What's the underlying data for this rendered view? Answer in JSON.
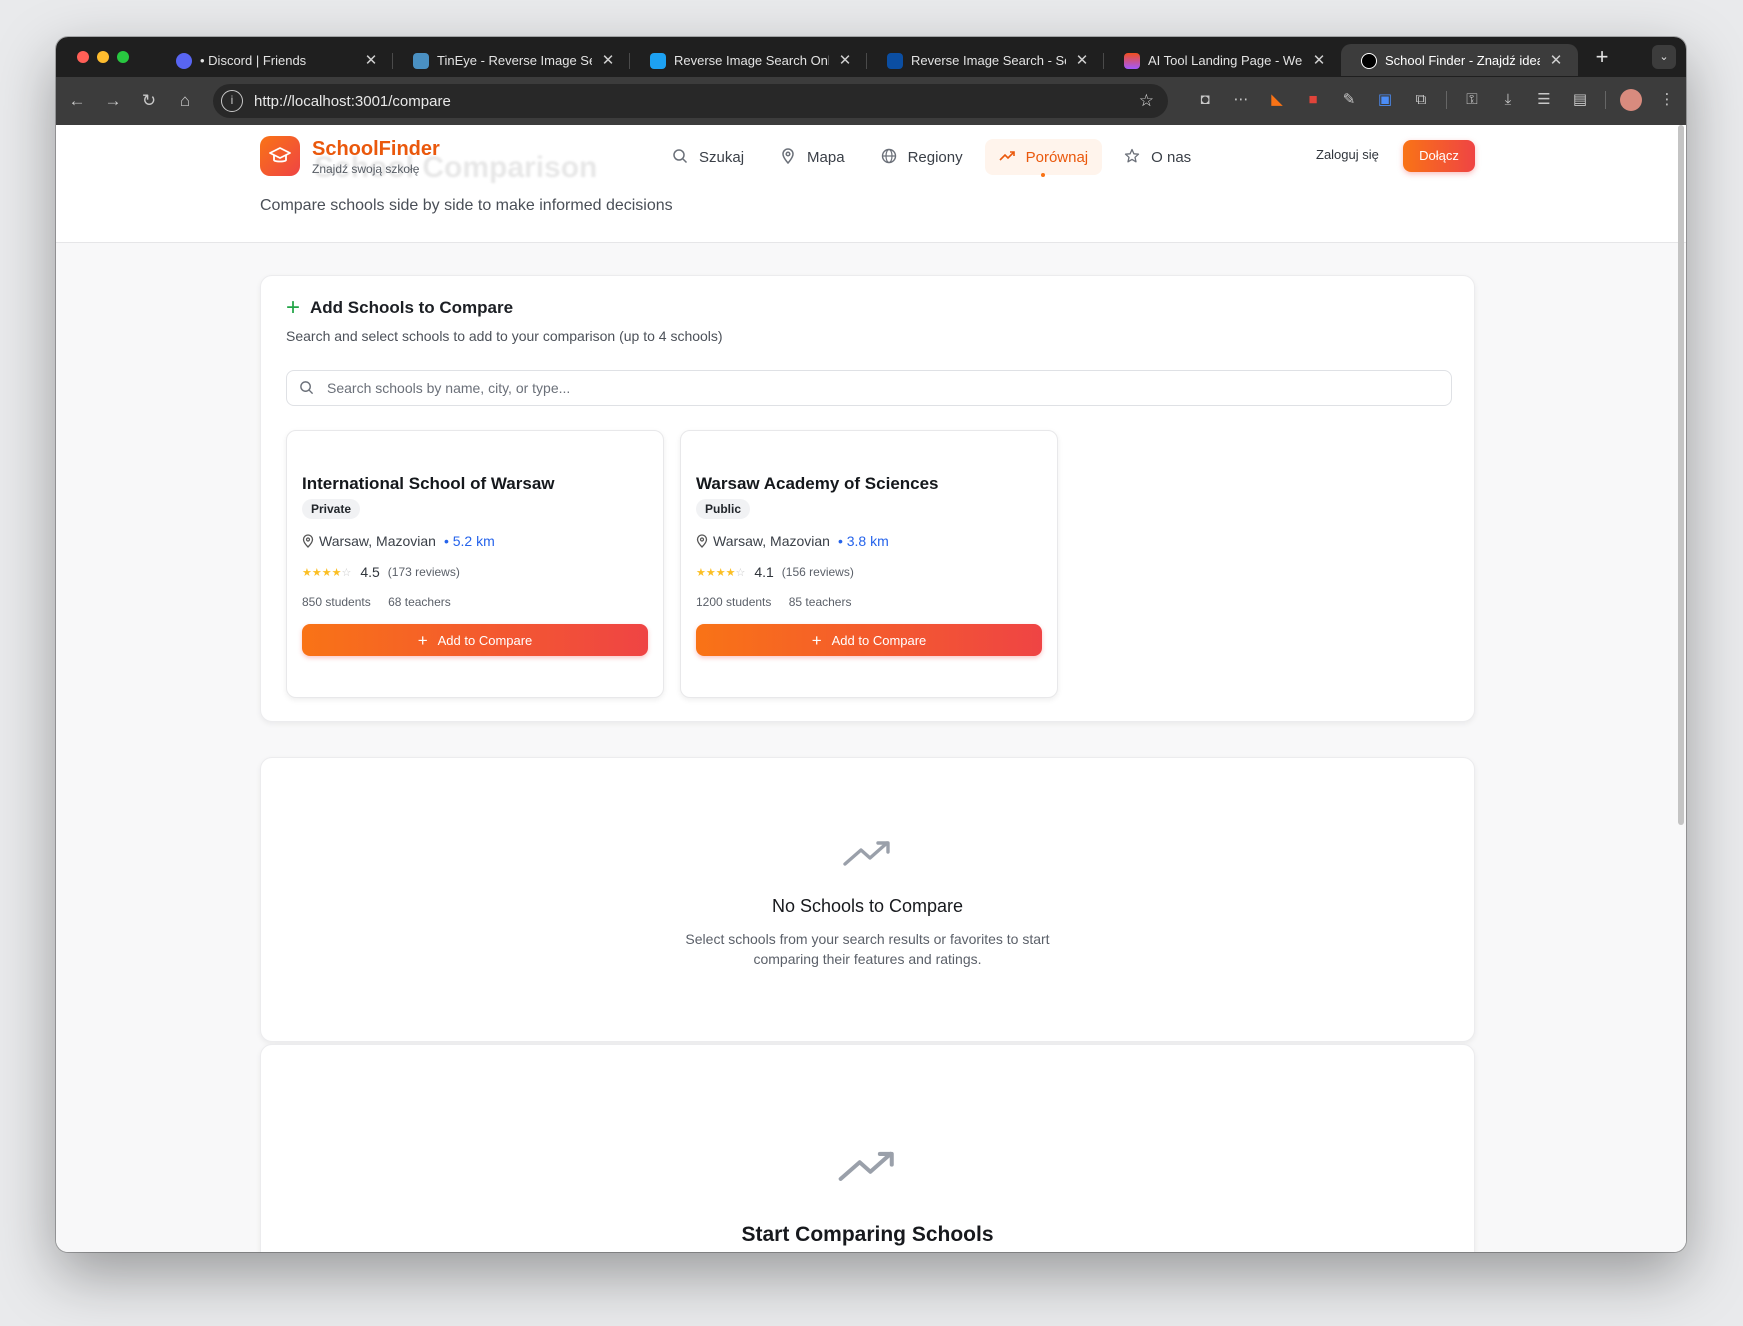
{
  "browser": {
    "tabs": [
      {
        "label": "• Discord | Friends",
        "icon": "discord-icon",
        "color": "#5865f2",
        "active": false
      },
      {
        "label": "TinEye - Reverse Image Search",
        "icon": "tineye-icon",
        "color": "#4a90c2",
        "active": false
      },
      {
        "label": "Reverse Image Search Online",
        "icon": "shield-icon",
        "color": "#1da1f2",
        "active": false
      },
      {
        "label": "Reverse Image Search - Search",
        "icon": "bing-icon",
        "color": "#0b4ea2",
        "active": false
      },
      {
        "label": "AI Tool Landing Page - Website",
        "icon": "figma-icon",
        "color": "#f24e1e",
        "active": false
      },
      {
        "label": "School Finder - Znajdź idealną",
        "icon": "nextjs-icon",
        "color": "#000000",
        "active": true
      }
    ],
    "url": "http://localhost:3001/compare"
  },
  "nav": {
    "logo_name": "SchoolFinder",
    "logo_tagline": "Znajdź swoją szkołę",
    "links": [
      {
        "label": "Szukaj",
        "icon": "search-icon",
        "active": false
      },
      {
        "label": "Mapa",
        "icon": "map-pin-icon",
        "active": false
      },
      {
        "label": "Regiony",
        "icon": "globe-icon",
        "active": false
      },
      {
        "label": "Porównaj",
        "icon": "trending-up-icon",
        "active": true
      },
      {
        "label": "O nas",
        "icon": "star-icon",
        "active": false
      }
    ],
    "login_label": "Zaloguj się",
    "join_label": "Dołącz"
  },
  "hero": {
    "ghost_title": "School Comparison",
    "subtitle": "Compare schools side by side to make informed decisions"
  },
  "add_section": {
    "title": "Add Schools to Compare",
    "description": "Search and select schools to add to your comparison (up to 4 schools)",
    "search_placeholder": "Search schools by name, city, or type...",
    "search_value": ""
  },
  "schools": [
    {
      "name": "International School of Warsaw",
      "type": "Private",
      "location": "Warsaw, Mazovian",
      "distance": "• 5.2 km",
      "rating": 4.5,
      "rating_text": "4.5",
      "reviews": "(173 reviews)",
      "students": "850 students",
      "teachers": "68 teachers",
      "button_label": "Add to Compare"
    },
    {
      "name": "Warsaw Academy of Sciences",
      "type": "Public",
      "location": "Warsaw, Mazovian",
      "distance": "• 3.8 km",
      "rating": 4.1,
      "rating_text": "4.1",
      "reviews": "(156 reviews)",
      "students": "1200 students",
      "teachers": "85 teachers",
      "button_label": "Add to Compare"
    }
  ],
  "empty_state": {
    "title": "No Schools to Compare",
    "description": "Select schools from your search results or favorites to start comparing their features and ratings."
  },
  "start_state": {
    "title": "Start Comparing Schools"
  },
  "dev_badge": "N",
  "colors": {
    "accent": "#f97316",
    "accent_end": "#ef4444",
    "link": "#2563eb",
    "success": "#22a447",
    "star": "#fbbf24"
  }
}
